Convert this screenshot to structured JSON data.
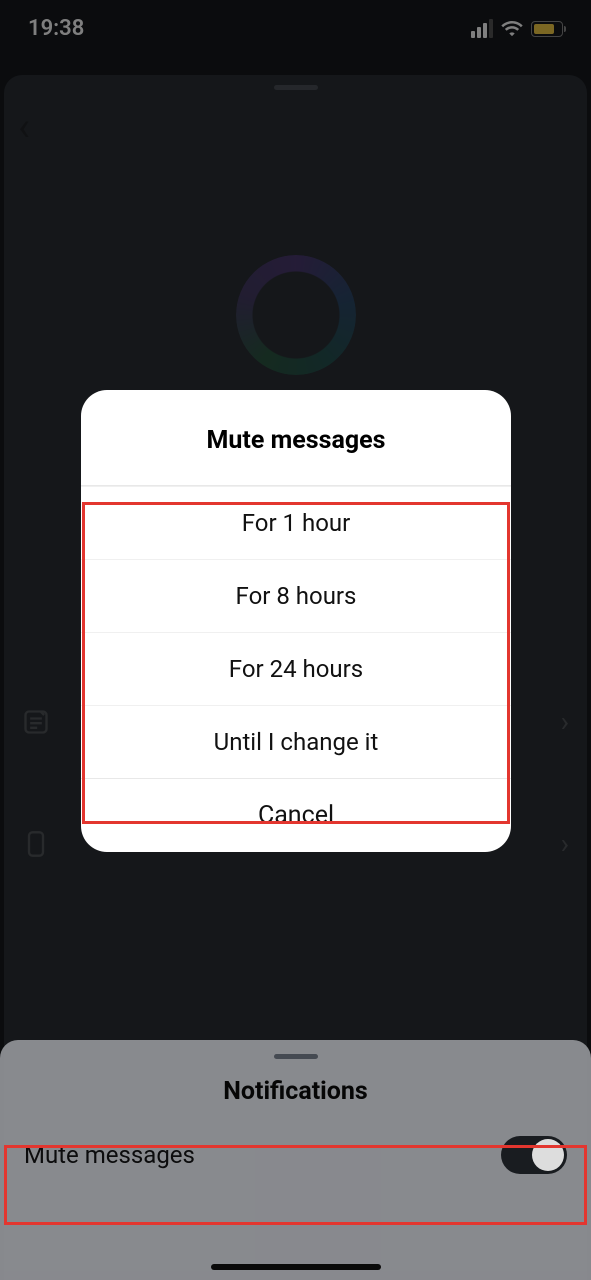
{
  "status_bar": {
    "time": "19:38"
  },
  "background": {
    "back": "‹"
  },
  "modal": {
    "title": "Mute messages",
    "options": [
      "For 1 hour",
      "For 8 hours",
      "For 24 hours",
      "Until I change it"
    ],
    "cancel": "Cancel"
  },
  "bottom_panel": {
    "title": "Notifications",
    "row_label": "Mute messages"
  }
}
